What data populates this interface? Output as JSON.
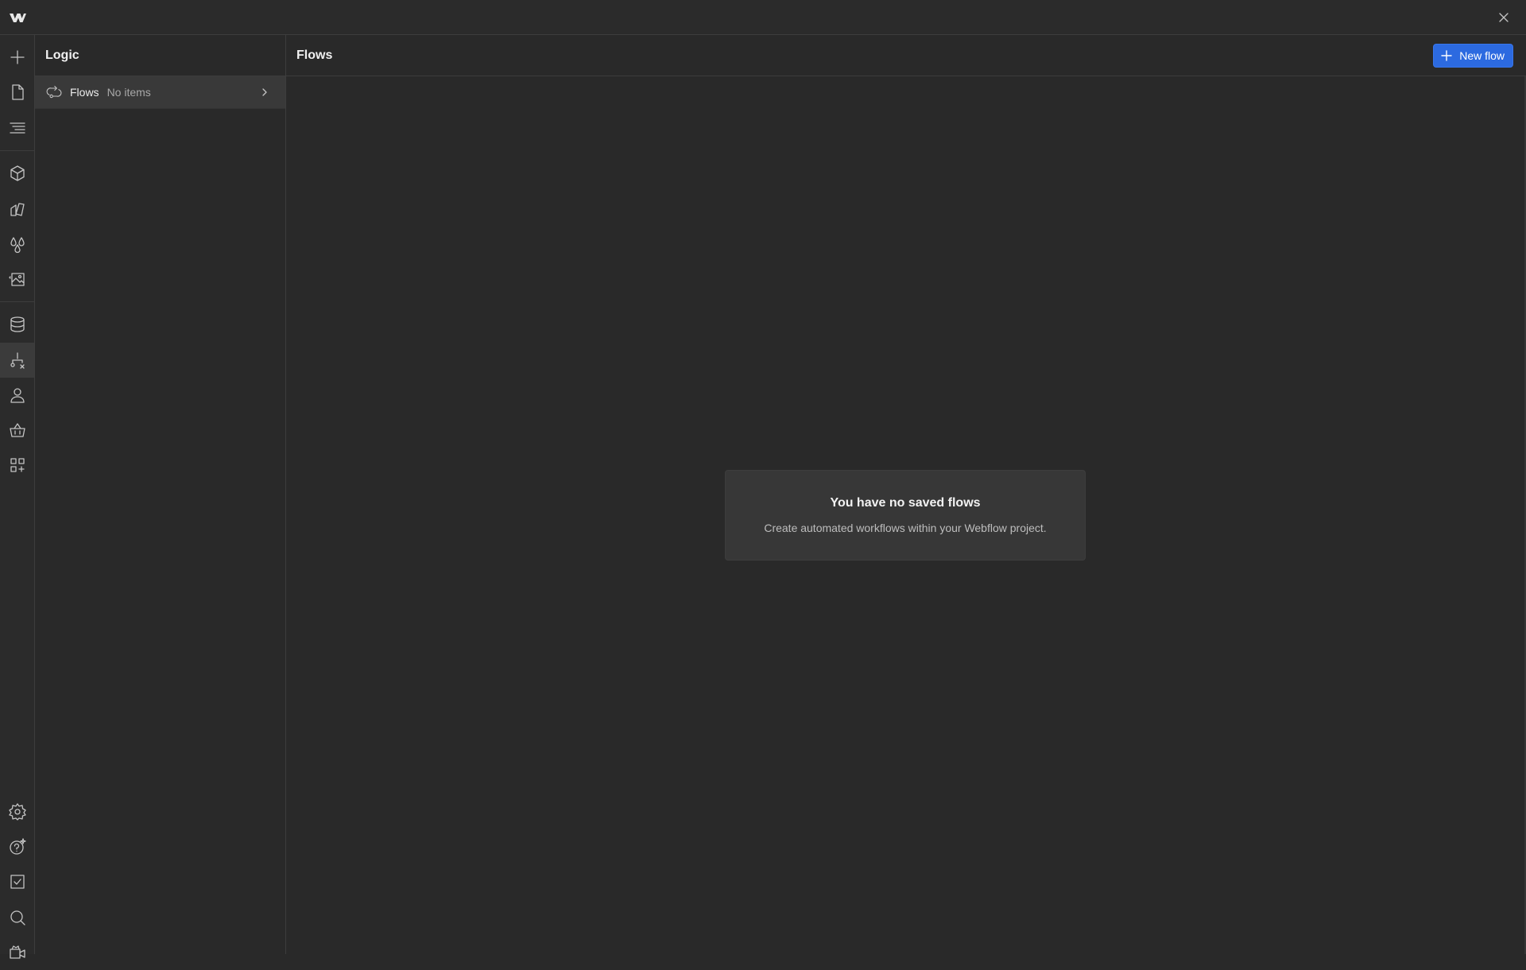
{
  "topbar": {
    "logo_icon": "webflow-logo-icon",
    "close_icon": "close-icon"
  },
  "rail": {
    "items": [
      {
        "name": "add-icon"
      },
      {
        "name": "pages-icon"
      },
      {
        "name": "navigator-icon"
      },
      {
        "name": "components-icon"
      },
      {
        "name": "style-selectors-icon"
      },
      {
        "name": "variables-icon"
      },
      {
        "name": "assets-icon"
      },
      {
        "name": "cms-icon"
      },
      {
        "name": "logic-icon",
        "active": true
      },
      {
        "name": "users-icon"
      },
      {
        "name": "ecommerce-icon"
      },
      {
        "name": "apps-icon"
      },
      {
        "name": "settings-icon"
      },
      {
        "name": "help-icon"
      },
      {
        "name": "audit-icon"
      },
      {
        "name": "search-icon"
      },
      {
        "name": "video-tutorials-icon"
      }
    ]
  },
  "panel": {
    "title": "Logic",
    "rows": [
      {
        "label": "Flows",
        "count": "No items",
        "icon": "flows-icon"
      }
    ]
  },
  "main": {
    "title": "Flows",
    "new_button_label": "New flow",
    "empty_state": {
      "title": "You have no saved flows",
      "description": "Create automated workflows within your Webflow project."
    }
  },
  "colors": {
    "accent": "#2c6ae0",
    "background": "#292929",
    "rail_active": "#3b3b3b"
  }
}
